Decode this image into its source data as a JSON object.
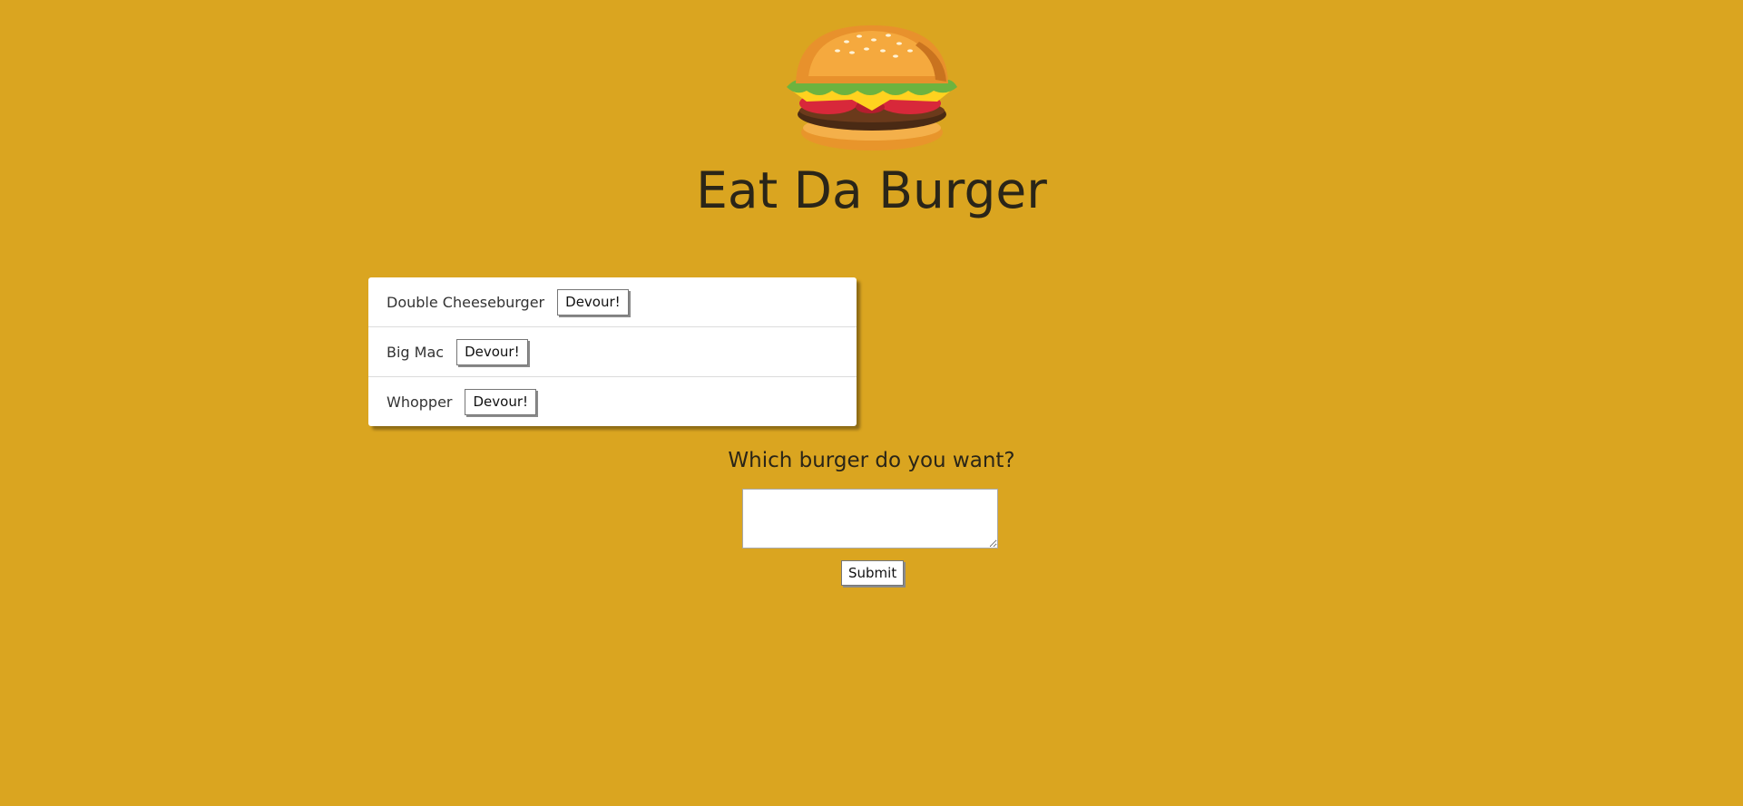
{
  "header": {
    "logo_icon": "hamburger-icon",
    "title": "Eat Da Burger"
  },
  "burgers": {
    "items": [
      {
        "name": "Double Cheeseburger",
        "button_label": "Devour!"
      },
      {
        "name": "Big Mac",
        "button_label": "Devour!"
      },
      {
        "name": "Whopper",
        "button_label": "Devour!"
      }
    ]
  },
  "form": {
    "question": "Which burger do you want?",
    "input_value": "",
    "submit_label": "Submit"
  },
  "colors": {
    "background": "#DAA520",
    "card": "#FFFFFF"
  }
}
